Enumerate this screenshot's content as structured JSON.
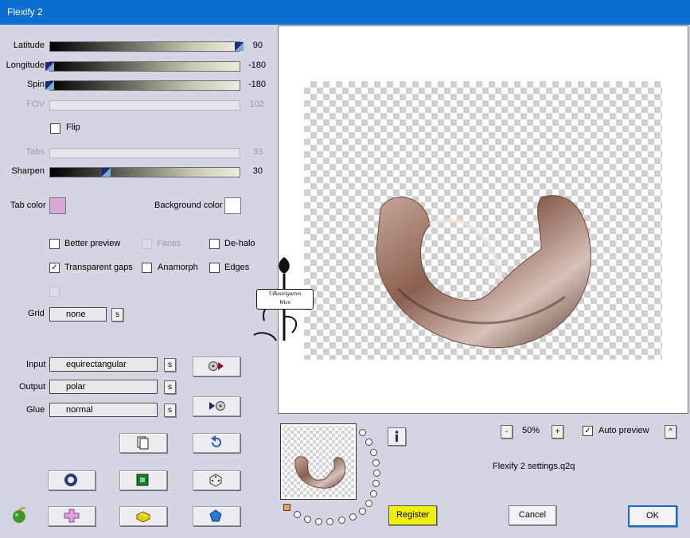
{
  "window": {
    "title": "Flexify 2"
  },
  "sliders": {
    "latitude": {
      "label": "Latitude",
      "value": "90",
      "fraction": 1.0
    },
    "longitude": {
      "label": "Longitude",
      "value": "-180",
      "fraction": 0.0
    },
    "spin": {
      "label": "Spin",
      "value": "-180",
      "fraction": 0.0
    },
    "fov": {
      "label": "FOV",
      "value": "102"
    },
    "tabs": {
      "label": "Tabs",
      "value": "33"
    },
    "sharpen": {
      "label": "Sharpen",
      "value": "30",
      "fraction": 0.3
    }
  },
  "flip": {
    "label": "Flip",
    "checked": false
  },
  "colors": {
    "tab_label": "Tab color",
    "tab_value": "#d8a8d8",
    "background_label": "Background color",
    "background_value": "#ffffff"
  },
  "options": {
    "better_preview": "Better preview",
    "faces": "Faces",
    "de_halo": "De-halo",
    "transparent_gaps": "Transparent gaps",
    "anamorph": "Anamorph",
    "edges": "Edges"
  },
  "grid": {
    "label": "Grid",
    "value": "none",
    "s": "s"
  },
  "projection": {
    "input_label": "Input",
    "input_value": "equirectangular",
    "output_label": "Output",
    "output_value": "polar",
    "glue_label": "Glue",
    "glue_value": "normal",
    "s": "s"
  },
  "zoom": {
    "minus": "-",
    "value": "50%",
    "plus": "+"
  },
  "auto_preview": {
    "label": "Auto preview",
    "checked": true,
    "toggle": "^"
  },
  "settings_file": "Flexify 2 settings.q2q",
  "buttons": {
    "register": "Register",
    "cancel": "Cancel",
    "ok": "OK"
  },
  "watermark": {
    "line1": "©Bastelgarten",
    "line2": "Wien"
  }
}
